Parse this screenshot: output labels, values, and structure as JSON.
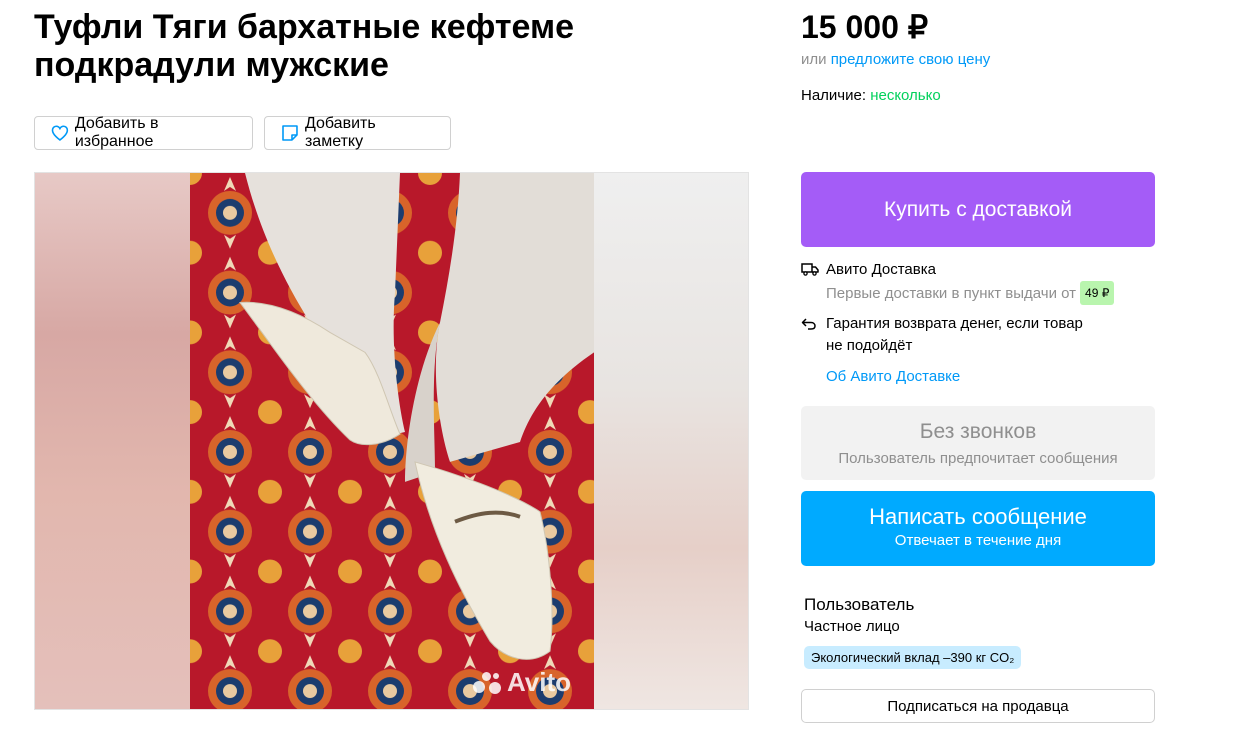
{
  "listing": {
    "title": "Туфли Тяги бархатные кефтеме подкрадули мужские"
  },
  "actions": {
    "favorite_label": "Добавить в избранное",
    "note_label": "Добавить заметку"
  },
  "gallery": {
    "watermark": "Avito"
  },
  "pricing": {
    "price": "15 000 ₽",
    "or_text": "или ",
    "offer_link": "предложите свою цену",
    "availability_label": "Наличие: ",
    "availability_value": "несколько"
  },
  "buy": {
    "label": "Купить с доставкой"
  },
  "delivery": {
    "title": "Авито Доставка",
    "first_delivery": "Первые доставки в пункт выдачи от",
    "price_badge": "49 ₽",
    "guarantee_line1": "Гарантия возврата денег, если товар",
    "guarantee_line2": "не подойдёт",
    "about_link": "Об Авито Доставке"
  },
  "contact": {
    "no_calls_title": "Без звонков",
    "no_calls_sub": "Пользователь предпочитает сообщения",
    "message_title": "Написать сообщение",
    "message_sub": "Отвечает в течение дня"
  },
  "seller": {
    "name": "Пользователь",
    "type": "Частное лицо",
    "eco_badge": "Экологический вклад –390 кг CO₂",
    "subscribe_label": "Подписаться на продавца"
  },
  "colors": {
    "buy_purple": "#a45cf7",
    "message_blue": "#00aaff",
    "link_blue": "#0099f7",
    "available_green": "#02d15c",
    "price_badge_green": "#b9f5ae",
    "eco_badge_blue": "#c8ecff"
  },
  "icons": {
    "favorite": "heart-icon",
    "note": "note-icon",
    "delivery": "truck-icon",
    "return": "return-arrow-icon",
    "watermark": "avito-logo-icon"
  }
}
